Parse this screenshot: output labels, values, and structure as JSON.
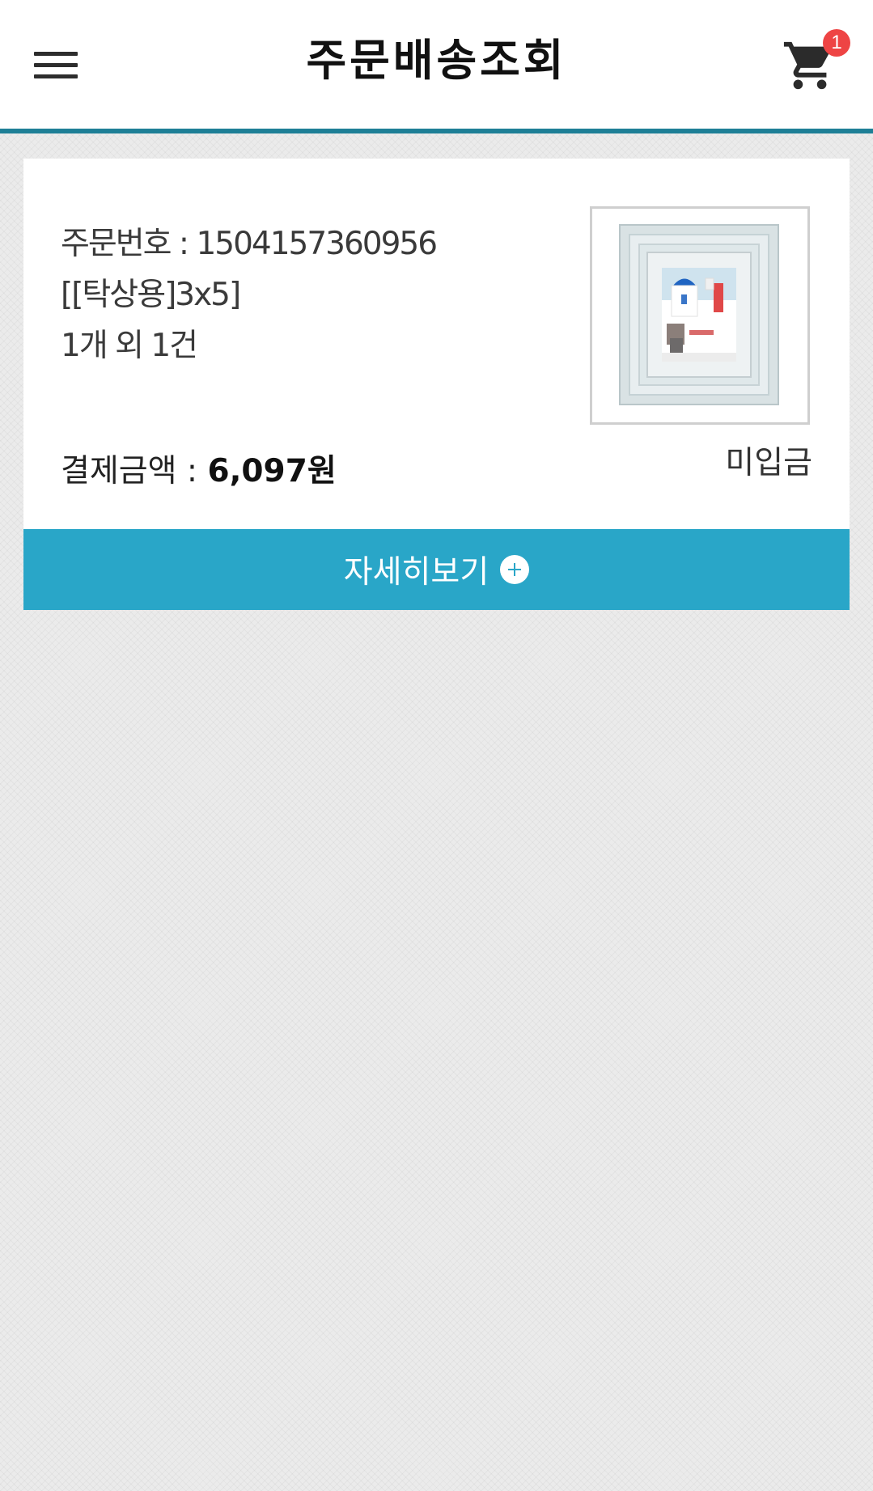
{
  "header": {
    "title": "주문배송조회",
    "menu_icon": "hamburger-menu-icon",
    "cart_icon": "shopping-cart-icon",
    "cart_count": "1",
    "accent_color": "#1e7f96"
  },
  "order": {
    "order_number": "주문번호 : 1504157360956",
    "product_name": "[[탁상용]3x5]",
    "quantity_text": "1개 외 1건",
    "payment_label": "결제금액 : ",
    "payment_amount": "6,097원",
    "payment_status": "미입금",
    "thumbnail": "framed-photo-thumbnail"
  },
  "detail_button": {
    "label": "자세히보기",
    "icon": "plus-circle-icon",
    "color": "#29a6c8"
  }
}
